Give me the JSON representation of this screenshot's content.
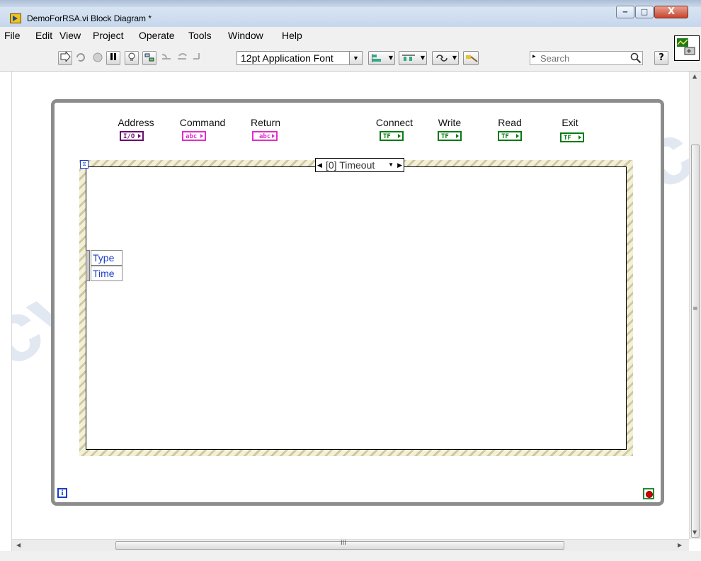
{
  "window": {
    "title": "DemoForRSA.vi Block Diagram *",
    "buttons": {
      "minimize": "‒",
      "maximize": "□",
      "close": "X"
    }
  },
  "menu": [
    "File",
    "Edit",
    "View",
    "Project",
    "Operate",
    "Tools",
    "Window",
    "Help"
  ],
  "toolbar": {
    "font_selector": "12pt Application Font",
    "search_placeholder": "Search",
    "help_glyph": "?"
  },
  "diagram": {
    "controls": {
      "address": {
        "label": "Address",
        "terminal": "I/O"
      },
      "command": {
        "label": "Command",
        "terminal": "abc"
      },
      "return": {
        "label": "Return",
        "terminal": "abc"
      },
      "connect": {
        "label": "Connect",
        "terminal": "TF"
      },
      "write": {
        "label": "Write",
        "terminal": "TF"
      },
      "read": {
        "label": "Read",
        "terminal": "TF"
      },
      "exit": {
        "label": "Exit",
        "terminal": "TF"
      }
    },
    "event_structure": {
      "selector_label": "[0] Timeout",
      "event_data": [
        "Type",
        "Time"
      ]
    },
    "iteration_terminal": "i"
  },
  "watermark": "cynepoic",
  "colors": {
    "path_wire": "#6a0f6a",
    "string_wire": "#e030c8",
    "boolean_wire": "#0b7a14",
    "loop_border": "#8c8c8c",
    "terminal_blue": "#1b3ec8"
  },
  "scrollbar": {
    "grip": "III"
  }
}
